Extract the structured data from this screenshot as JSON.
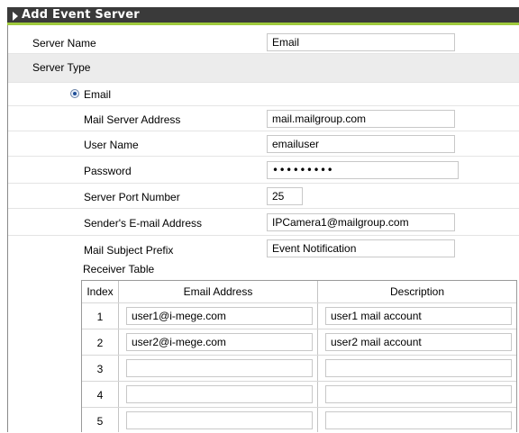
{
  "header": {
    "title": "Add Event Server"
  },
  "server_name": {
    "label": "Server Name",
    "value": "Email"
  },
  "server_type": {
    "label": "Server Type",
    "selected_option": "Email"
  },
  "fields": {
    "mail_server_address": {
      "label": "Mail Server Address",
      "value": "mail.mailgroup.com"
    },
    "user_name": {
      "label": "User Name",
      "value": "emailuser"
    },
    "password": {
      "label": "Password",
      "value": "•••••••••"
    },
    "server_port": {
      "label": "Server Port Number",
      "value": "25"
    },
    "sender_email": {
      "label": "Sender's E-mail Address",
      "value": "IPCamera1@mailgroup.com"
    },
    "subject_prefix": {
      "label": "Mail Subject Prefix",
      "value": "Event Notification"
    }
  },
  "receiver_table": {
    "title": "Receiver Table",
    "columns": [
      "Index",
      "Email Address",
      "Description"
    ],
    "rows": [
      {
        "index": "1",
        "email": "user1@i-mege.com",
        "description": "user1 mail account"
      },
      {
        "index": "2",
        "email": "user2@i-mege.com",
        "description": "user2 mail account"
      },
      {
        "index": "3",
        "email": "",
        "description": ""
      },
      {
        "index": "4",
        "email": "",
        "description": ""
      },
      {
        "index": "5",
        "email": "",
        "description": ""
      }
    ]
  },
  "colors": {
    "header_bg": "#3a3a3a",
    "header_accent": "#9fca3c",
    "row_grey": "#ececec"
  }
}
